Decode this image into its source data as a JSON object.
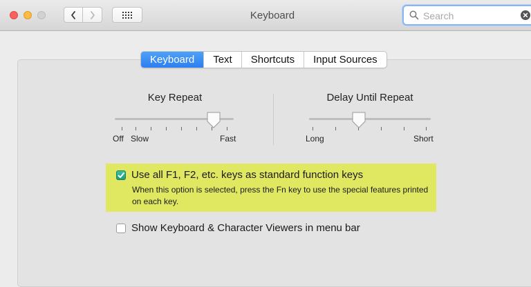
{
  "window": {
    "title": "Keyboard"
  },
  "toolbar": {
    "back_icon": "chevron-left-icon",
    "forward_icon": "chevron-right-icon",
    "show_all_icon": "grid-icon"
  },
  "search": {
    "placeholder": "Search",
    "value": ""
  },
  "tabs": [
    {
      "label": "Keyboard",
      "selected": true
    },
    {
      "label": "Text",
      "selected": false
    },
    {
      "label": "Shortcuts",
      "selected": false
    },
    {
      "label": "Input Sources",
      "selected": false
    }
  ],
  "key_repeat": {
    "title": "Key Repeat",
    "min_label": "Off",
    "slow_label": "Slow",
    "max_label": "Fast",
    "value_fraction": 0.8
  },
  "delay_until_repeat": {
    "title": "Delay Until Repeat",
    "min_label": "Long",
    "max_label": "Short",
    "value_fraction": 0.4
  },
  "options": {
    "fn_keys": {
      "label": "Use all F1, F2, etc. keys as standard function keys",
      "description": "When this option is selected, press the Fn key to use the special features printed on each key.",
      "checked": true
    },
    "viewers": {
      "label": "Show Keyboard & Character Viewers in menu bar",
      "checked": false
    }
  },
  "colors": {
    "accent_blue": "#2c7ff0",
    "highlight_yellow": "#e0e760",
    "checkbox_green": "#1f9c7c"
  }
}
